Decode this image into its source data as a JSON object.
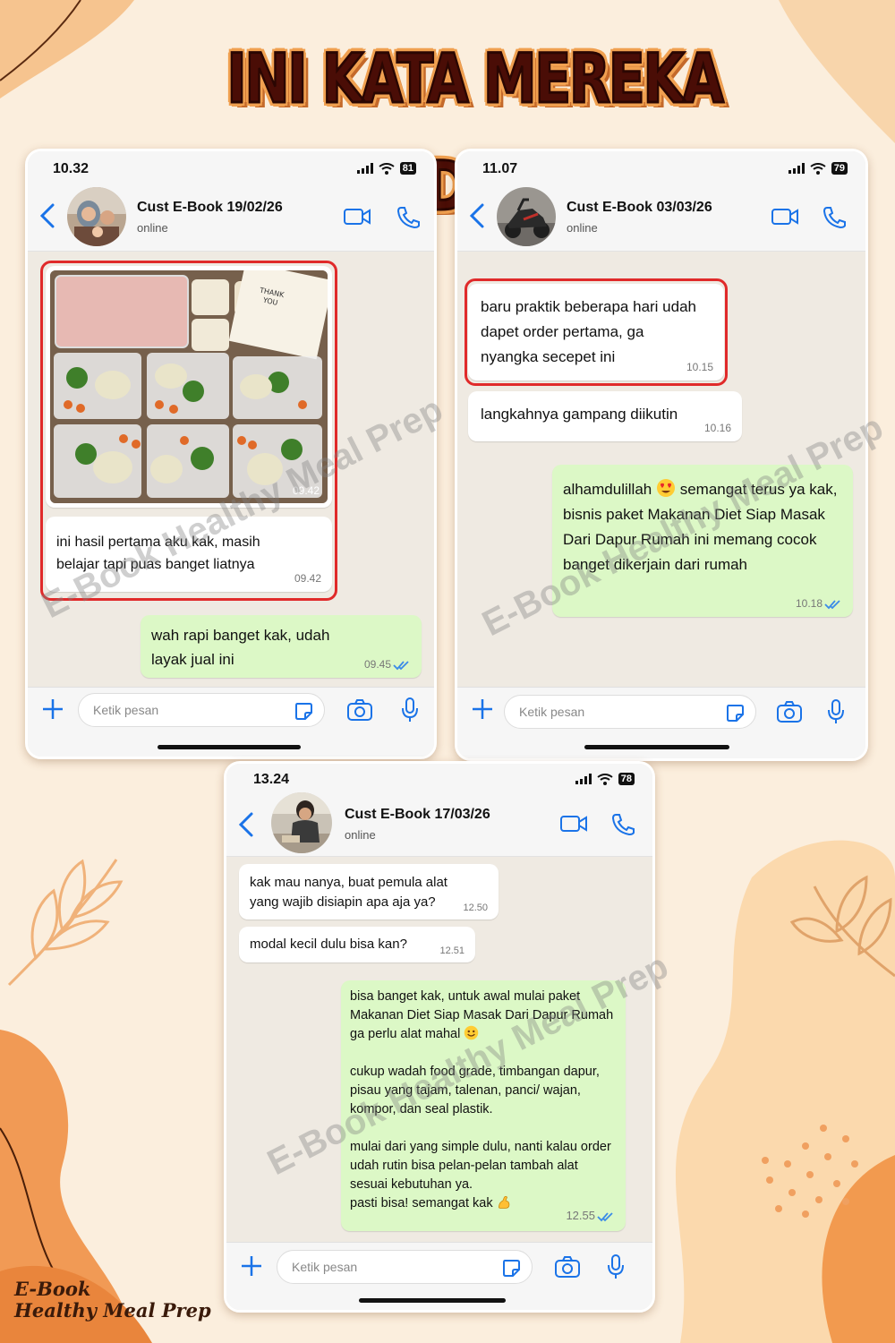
{
  "headline": "INI KATA MEREKA YANG UDAH JALAN",
  "watermark": "E-Book Healthy Meal Prep",
  "brand": {
    "line1": "E-Book",
    "line2": "Healthy Meal Prep"
  },
  "colors": {
    "background": "#fbeedd",
    "blob": "#f0a060",
    "bubble_out": "#dcf8c6",
    "highlight": "#e02a2a",
    "ios_blue": "#1a73e8"
  },
  "phones": [
    {
      "time": "10.32",
      "battery": "81",
      "contact": "Cust E-Book 19/02/26",
      "status": "online",
      "avatar_icon": "family-photo-avatar",
      "messages": [
        {
          "side": "in",
          "kind": "image",
          "image": "meal-prep-boxes-photo",
          "time": "09.42"
        },
        {
          "side": "in",
          "text": "ini hasil pertama aku kak, masih belajar tapi puas banget liatnya",
          "time": "09.42"
        },
        {
          "side": "out",
          "text": "wah rapi banget kak, udah layak jual ini",
          "time": "09.45"
        }
      ],
      "input_placeholder": "Ketik pesan"
    },
    {
      "time": "11.07",
      "battery": "79",
      "contact": "Cust E-Book 03/03/26",
      "status": "online",
      "avatar_icon": "scooter-photo-avatar",
      "messages": [
        {
          "side": "in",
          "text": "baru praktik beberapa hari udah dapet order pertama, ga nyangka secepet ini",
          "time": "10.15"
        },
        {
          "side": "in",
          "text": "langkahnya gampang diikutin",
          "time": "10.16"
        },
        {
          "side": "out",
          "text_before": "alhamdulillah",
          "emoji": "heart-eyes-emoji",
          "text_after": "semangat terus ya kak, bisnis paket Makanan Diet Siap Masak Dari Dapur Rumah ini memang cocok banget dikerjain dari rumah",
          "time": "10.18"
        }
      ],
      "input_placeholder": "Ketik pesan"
    },
    {
      "time": "13.24",
      "battery": "78",
      "contact": "Cust E-Book 17/03/26",
      "status": "online",
      "avatar_icon": "woman-cooking-photo-avatar",
      "messages": [
        {
          "side": "in",
          "text": "kak mau nanya, buat pemula alat yang wajib disiapin apa aja ya?",
          "time": "12.50"
        },
        {
          "side": "in",
          "text": "modal kecil dulu bisa kan?",
          "time": "12.51"
        },
        {
          "side": "out",
          "p1": "bisa banget kak, untuk awal mulai paket Makanan Diet Siap Masak Dari Dapur Rumah ga perlu alat mahal",
          "p2": "cukup wadah food grade, timbangan dapur, pisau yang tajam, talenan, panci/ wajan, kompor, dan seal plastik.",
          "p3": "mulai dari yang simple dulu, nanti kalau order udah rutin bisa pelan-pelan tambah alat sesuai kebutuhan ya.",
          "p4": "pasti bisa! semangat kak",
          "time": "12.55"
        }
      ],
      "input_placeholder": "Ketik pesan"
    }
  ]
}
